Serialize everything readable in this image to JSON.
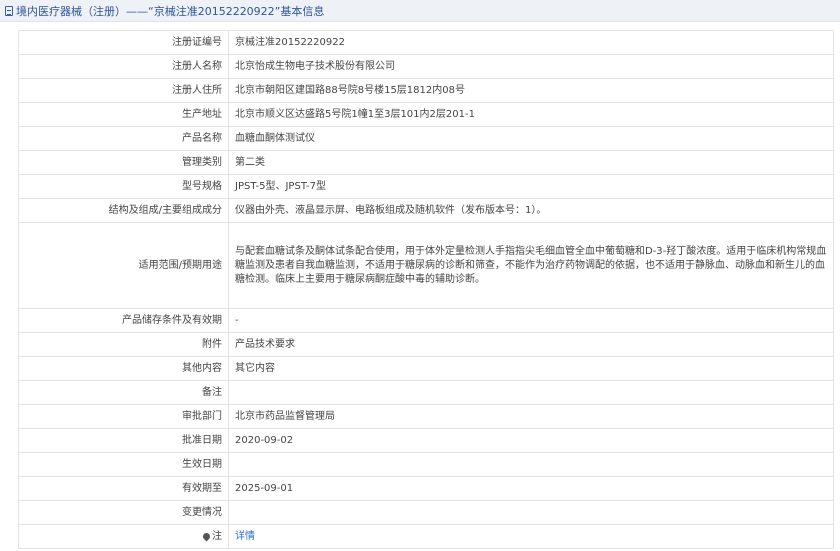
{
  "header": {
    "icon": "document-icon",
    "title": "境内医疗器械（注册）——“京械注准20152220922”基本信息"
  },
  "rows": [
    {
      "label": "注册证编号",
      "value": "京械注准20152220922"
    },
    {
      "label": "注册人名称",
      "value": "北京怡成生物电子技术股份有限公司"
    },
    {
      "label": "注册人住所",
      "value": "北京市朝阳区建国路88号院8号楼15层1812内08号"
    },
    {
      "label": "生产地址",
      "value": "北京市顺义区达盛路5号院1幢1至3层101内2层201-1"
    },
    {
      "label": "产品名称",
      "value": "血糖血酮体测试仪"
    },
    {
      "label": "管理类别",
      "value": "第二类"
    },
    {
      "label": "型号规格",
      "value": "JPST-5型、JPST-7型"
    },
    {
      "label": "结构及组成/主要组成成分",
      "value": "仪器由外壳、液晶显示屏、电路板组成及随机软件（发布版本号：1）。"
    },
    {
      "label": "适用范围/预期用途",
      "value": "与配套血糖试条及酮体试条配合使用，用于体外定量检测人手指指尖毛细血管全血中葡萄糖和D-3-羟丁酸浓度。适用于临床机构常规血糖监测及患者自我血糖监测，不适用于糖尿病的诊断和筛查，不能作为治疗药物调配的依据，也不适用于静脉血、动脉血和新生儿的血糖检测。临床上主要用于糖尿病酮症酸中毒的辅助诊断。"
    },
    {
      "label": "产品储存条件及有效期",
      "value": "-"
    },
    {
      "label": "附件",
      "value": "产品技术要求"
    },
    {
      "label": "其他内容",
      "value": "其它内容"
    },
    {
      "label": "备注",
      "value": ""
    },
    {
      "label": "审批部门",
      "value": "北京市药品监督管理局"
    },
    {
      "label": "批准日期",
      "value": "2020-09-02"
    },
    {
      "label": "生效日期",
      "value": ""
    },
    {
      "label": "有效期至",
      "value": "2025-09-01"
    },
    {
      "label": "变更情况",
      "value": ""
    }
  ],
  "note_row": {
    "icon": "pin-icon",
    "label": "注",
    "link": "详情"
  }
}
